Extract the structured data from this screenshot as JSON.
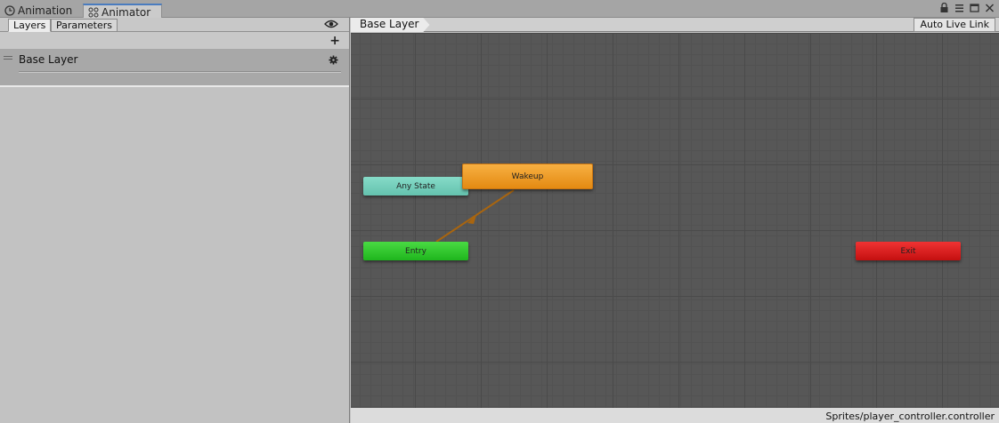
{
  "window_tabs": [
    {
      "label": "Animation",
      "icon": "clock-icon"
    },
    {
      "label": "Animator",
      "icon": "animator-icon"
    }
  ],
  "left_panel": {
    "tabs": [
      "Layers",
      "Parameters"
    ],
    "layers": [
      {
        "name": "Base Layer"
      }
    ]
  },
  "graph": {
    "breadcrumb": "Base Layer",
    "auto_live_link": "Auto Live Link",
    "nodes": {
      "any_state": "Any State",
      "wakeup": "Wakeup",
      "entry": "Entry",
      "exit": "Exit"
    },
    "controller_path": "Sprites/player_controller.controller"
  },
  "colors": {
    "any_state": "#6fcdb9",
    "wakeup": "#ee9a22",
    "entry": "#2cc42a",
    "exit": "#d61a1a",
    "transition": "#a9650f",
    "graph_bg": "#575757"
  }
}
